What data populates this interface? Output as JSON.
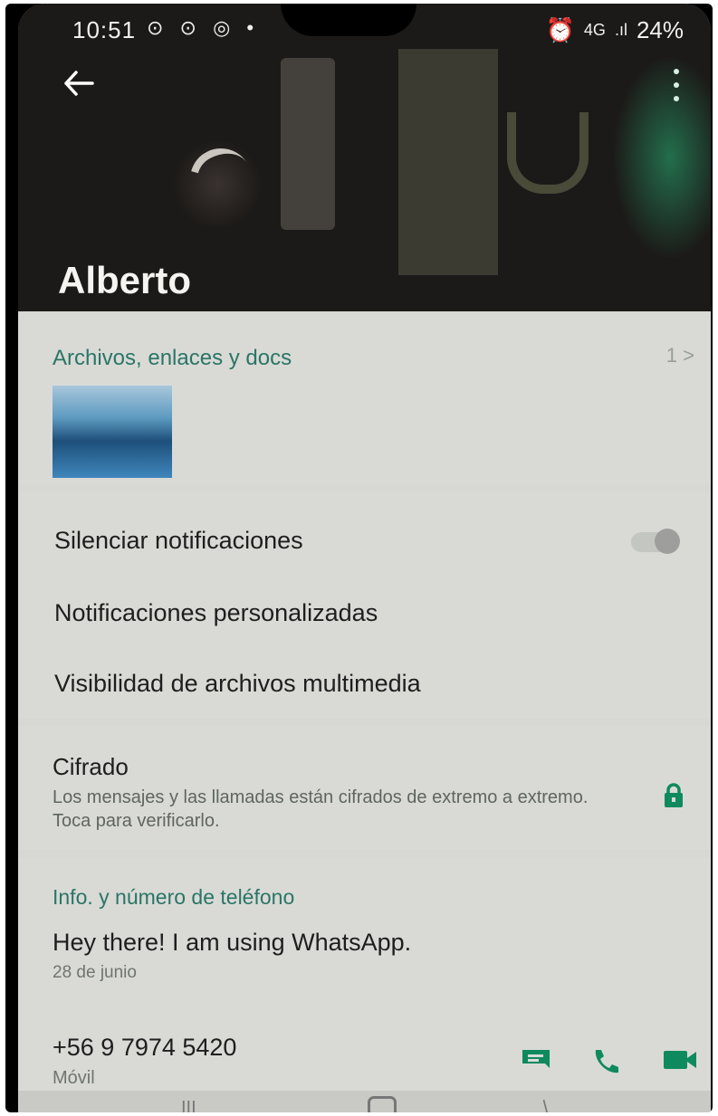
{
  "statusbar": {
    "time": "10:51",
    "left_icons": "⊙ ⊙ ◎ •",
    "network": "4G",
    "signal": ".ıl",
    "battery": "24%"
  },
  "header": {
    "contact_name": "Alberto"
  },
  "media": {
    "title": "Archivos, enlaces y docs",
    "count": "1 >"
  },
  "settings": {
    "mute_label": "Silenciar notificaciones",
    "mute_enabled": false,
    "custom_label": "Notificaciones personalizadas",
    "visibility_label": "Visibilidad de archivos multimedia"
  },
  "encryption": {
    "title": "Cifrado",
    "description": "Los mensajes y las llamadas están cifrados de extremo a extremo. Toca para verificarlo."
  },
  "info": {
    "title": "Info. y número de teléfono",
    "about": "Hey there! I am using WhatsApp.",
    "about_date": "28 de junio",
    "phone_number": "+56 9 7974 5420",
    "phone_type": "Móvil"
  },
  "colors": {
    "accent": "#2b7566",
    "icon_green": "#0f8a5f"
  }
}
